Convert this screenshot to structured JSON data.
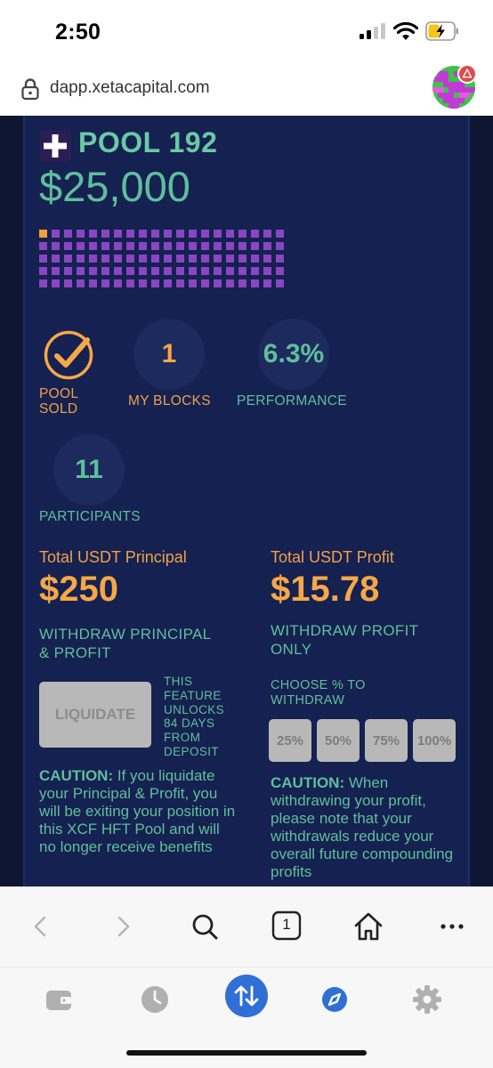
{
  "status_bar": {
    "time": "2:50"
  },
  "address_bar": {
    "url": "dapp.xetacapital.com"
  },
  "pool": {
    "title": "POOL 192",
    "amount": "$25,000",
    "blocks": {
      "total": 100,
      "owned": 1
    }
  },
  "stats": {
    "sold": {
      "label_line1": "POOL",
      "label_line2": "SOLD"
    },
    "my_blocks": {
      "value": "1",
      "label": "MY BLOCKS"
    },
    "performance": {
      "value": "6.3%",
      "label": "PERFORMANCE"
    },
    "participants": {
      "value": "11",
      "label": "PARTICIPANTS"
    }
  },
  "principal": {
    "heading": "Total USDT Principal",
    "amount": "$250",
    "withdraw_line1": "WITHDRAW PRINCIPAL",
    "withdraw_line2": "& PROFIT",
    "liquidate_label": "LIQUIDATE",
    "unlock_lines": [
      "THIS",
      "FEATURE",
      "UNLOCKS",
      "84 DAYS",
      "FROM",
      "DEPOSIT"
    ],
    "caution_label": "CAUTION:",
    "caution_text": " If you liquidate your Principal & Profit, you will be exiting your position in this XCF HFT Pool and will no longer receive benefits"
  },
  "profit": {
    "heading": "Total USDT Profit",
    "amount": "$15.78",
    "withdraw_line1": "WITHDRAW PROFIT",
    "withdraw_line2": "ONLY",
    "choose_line1": "CHOOSE % TO",
    "choose_line2": "WITHDRAW",
    "percent_options": [
      "25%",
      "50%",
      "75%",
      "100%"
    ],
    "caution_label": "CAUTION:",
    "caution_text": " When withdrawing your profit, please note that your withdrawals reduce your overall future compounding profits"
  },
  "toolbar": {
    "tab_count": "1"
  },
  "colors": {
    "green": "#5fbf9c",
    "orange": "#f6a747",
    "purple_block": "#8a45c2",
    "card_bg": "#152150",
    "page_bg": "#0e1633",
    "active_tab": "#2f6fd6"
  },
  "icons": {
    "status": [
      "signal-icon",
      "wifi-icon",
      "battery-charging-icon"
    ],
    "toolbar": [
      "back-icon",
      "forward-icon",
      "search-icon",
      "tabs-icon",
      "home-icon",
      "more-icon"
    ],
    "tabbar": [
      "wallet-icon",
      "history-icon",
      "swap-icon",
      "explore-icon",
      "settings-icon"
    ]
  }
}
